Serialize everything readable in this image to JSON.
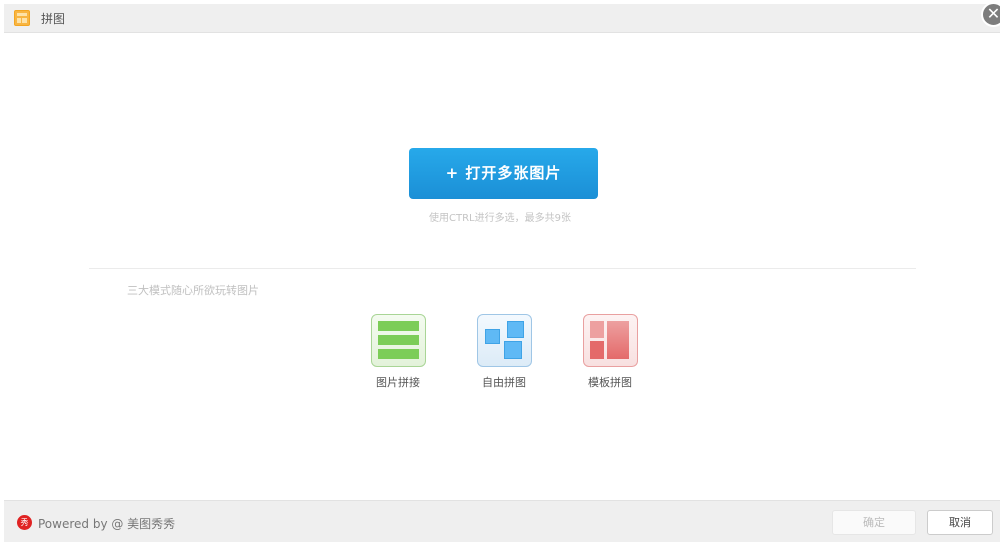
{
  "header": {
    "title": "拼图",
    "icon": "puzzle-app-icon",
    "close_icon": "close-icon"
  },
  "main": {
    "open_button": "+ 打开多张图片",
    "hint": "使用CTRL进行多选，最多共9张",
    "modes_label": "三大模式随心所欲玩转图片",
    "modes": [
      {
        "label": "图片拼接",
        "icon": "stitch-icon",
        "color": "#7ccd58"
      },
      {
        "label": "自由拼图",
        "icon": "free-collage-icon",
        "color": "#5fb9f5"
      },
      {
        "label": "模板拼图",
        "icon": "template-collage-icon",
        "color": "#e46a6a"
      }
    ]
  },
  "footer": {
    "powered_by": "Powered by @ 美图秀秀",
    "logo_text": "秀",
    "ok": "确定",
    "cancel": "取消"
  }
}
